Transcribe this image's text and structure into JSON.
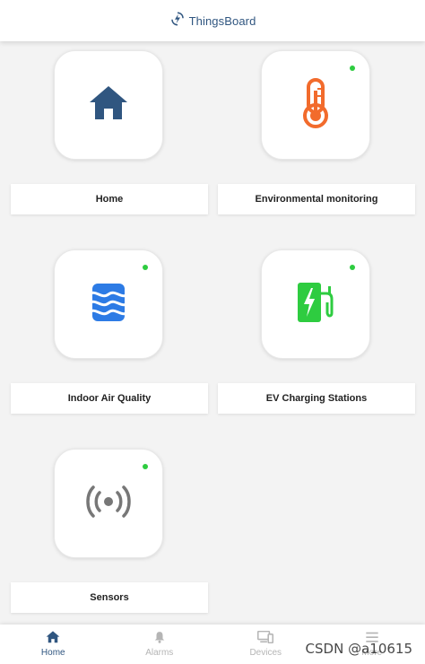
{
  "header": {
    "title": "ThingsBoard",
    "logo_icon": "thingsboard-logo-icon"
  },
  "dashboards": [
    {
      "label": "Home",
      "icon": "home-icon",
      "icon_color": "#305680",
      "active_indicator": false
    },
    {
      "label": "Environmental monitoring",
      "icon": "thermometer-icon",
      "icon_color": "#f26b2c",
      "active_indicator": true
    },
    {
      "label": "Indoor Air Quality",
      "icon": "air-quality-icon",
      "icon_color": "#2d7be5",
      "active_indicator": true
    },
    {
      "label": "EV Charging Stations",
      "icon": "ev-charging-icon",
      "icon_color": "#2ecc40",
      "active_indicator": true
    },
    {
      "label": "Sensors",
      "icon": "sensor-broadcast-icon",
      "icon_color": "#777777",
      "active_indicator": true
    }
  ],
  "bottom_nav": [
    {
      "label": "Home",
      "icon": "home-icon",
      "active": true
    },
    {
      "label": "Alarms",
      "icon": "bell-icon",
      "active": false
    },
    {
      "label": "Devices",
      "icon": "devices-icon",
      "active": false
    },
    {
      "label": "More",
      "icon": "menu-icon",
      "active": false
    }
  ],
  "colors": {
    "accent": "#305680",
    "status_online": "#2ecc40"
  },
  "watermark": "CSDN @a10615"
}
